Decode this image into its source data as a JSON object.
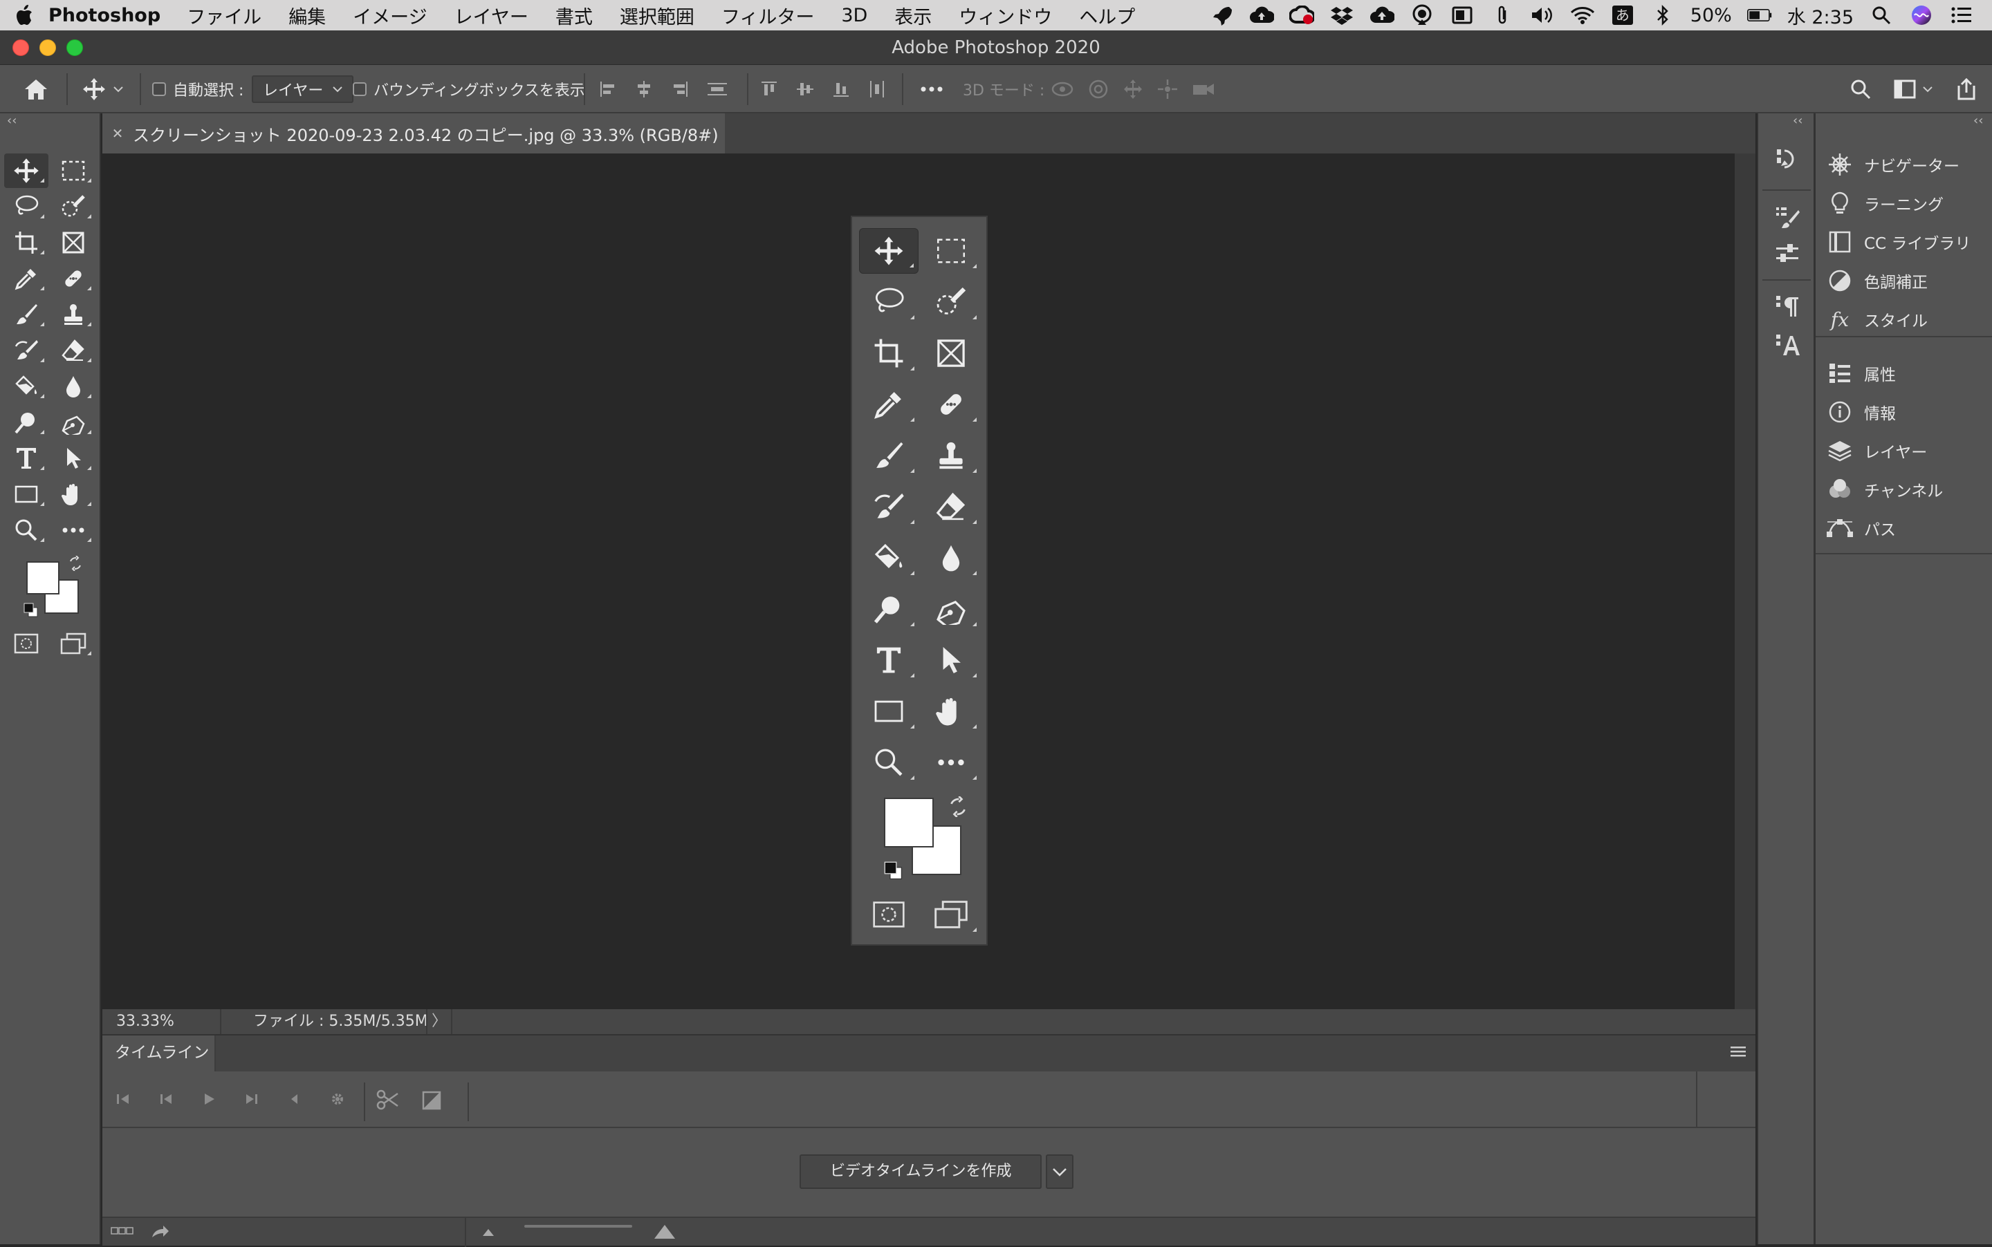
{
  "menubar": {
    "app_name": "Photoshop",
    "items": [
      "ファイル",
      "編集",
      "イメージ",
      "レイヤー",
      "書式",
      "選択範囲",
      "フィルター",
      "3D",
      "表示",
      "ウィンドウ",
      "ヘルプ"
    ],
    "battery": "50%",
    "ime": "あ",
    "clock": "水 2:35"
  },
  "window": {
    "title": "Adobe Photoshop 2020"
  },
  "options": {
    "auto_select_label": "自動選択 :",
    "auto_select_value": "レイヤー",
    "bounding_box_label": "バウンディングボックスを表示",
    "three_d_mode_label": "3D モード :"
  },
  "document": {
    "tab_title": "スクリーンショット 2020-09-23 2.03.42 のコピー.jpg @ 33.3% (RGB/8#)",
    "zoom": "33.33%",
    "file_info": "ファイル : 5.35M/5.35M"
  },
  "timeline": {
    "tab_label": "タイムライン",
    "create_button": "ビデオタイムラインを作成"
  },
  "right_panel": {
    "group1": [
      "ナビゲーター",
      "ラーニング",
      "CC ライブラリ",
      "色調補正",
      "スタイル"
    ],
    "group2": [
      "属性",
      "情報",
      "レイヤー",
      "チャンネル",
      "パス"
    ]
  },
  "colors": {
    "ui_dark": "#282828",
    "panel": "#535353",
    "foreground_color": "#ffffff",
    "background_color": "#ffffff"
  }
}
